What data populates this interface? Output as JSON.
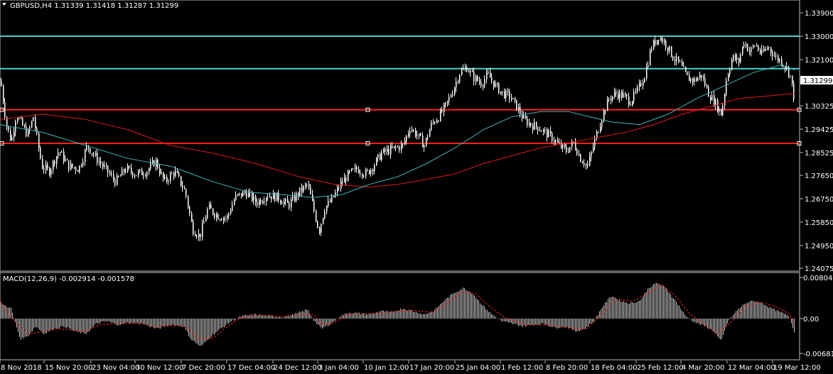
{
  "header": {
    "symbol_line": "GBPUSD,H4  1.31339 1.31418 1.31287 1.31299",
    "macd_line": "MACD(12,26,9) -0.002914 -0.001578"
  },
  "colors": {
    "background": "#000000",
    "candle": "#ffffff",
    "ma_fast": "#3fb8b8",
    "ma_slow": "#e01818",
    "hline_cyan": "#4fd0d0",
    "hline_red": "#ff2020",
    "macd_hist": "#c8c8c8",
    "macd_signal": "#ff2020",
    "price_tag_bg": "#ffffff",
    "price_tag_fg": "#000000"
  },
  "chart_data": [
    {
      "type": "candlestick",
      "name": "GBPUSD,H4",
      "current_price": "1.31299",
      "ylim": [
        1.24075,
        1.339
      ],
      "y_ticks": [
        "1.33900",
        "1.33000",
        "1.32100",
        "1.30325",
        "1.29425",
        "1.28525",
        "1.27650",
        "1.26750",
        "1.25850",
        "1.24950",
        "1.24075"
      ],
      "x_ticks": [
        "8 Nov 2018",
        "15 Nov 20:00",
        "23 Nov 04:00",
        "30 Nov 12:00",
        "7 Dec 20:00",
        "17 Dec 04:00",
        "24 Dec 12:00",
        "3 Jan 04:00",
        "10 Jan 12:00",
        "17 Jan 20:00",
        "25 Jan 04:00",
        "1 Feb 12:00",
        "8 Feb 20:00",
        "18 Feb 04:00",
        "25 Feb 12:00",
        "4 Mar 20:00",
        "12 Mar 04:00",
        "19 Mar 12:00"
      ],
      "horizontal_levels": [
        {
          "price": 1.33,
          "color": "cyan"
        },
        {
          "price": 1.3175,
          "color": "cyan"
        },
        {
          "price": 1.3017,
          "color": "red"
        },
        {
          "price": 1.2888,
          "color": "red"
        }
      ],
      "close_path": [
        [
          0,
          1.313
        ],
        [
          8,
          1.296
        ],
        [
          15,
          1.2895
        ],
        [
          22,
          1.3
        ],
        [
          30,
          1.296
        ],
        [
          38,
          1.292
        ],
        [
          46,
          1.299
        ],
        [
          58,
          1.28
        ],
        [
          68,
          1.278
        ],
        [
          82,
          1.286
        ],
        [
          96,
          1.28
        ],
        [
          110,
          1.279
        ],
        [
          122,
          1.288
        ],
        [
          135,
          1.283
        ],
        [
          150,
          1.278
        ],
        [
          162,
          1.274
        ],
        [
          176,
          1.279
        ],
        [
          190,
          1.277
        ],
        [
          205,
          1.278
        ],
        [
          218,
          1.282
        ],
        [
          230,
          1.274
        ],
        [
          245,
          1.278
        ],
        [
          260,
          1.27
        ],
        [
          270,
          1.256
        ],
        [
          280,
          1.253
        ],
        [
          292,
          1.264
        ],
        [
          305,
          1.261
        ],
        [
          318,
          1.26
        ],
        [
          330,
          1.268
        ],
        [
          345,
          1.27
        ],
        [
          360,
          1.266
        ],
        [
          375,
          1.269
        ],
        [
          390,
          1.268
        ],
        [
          405,
          1.265
        ],
        [
          420,
          1.27
        ],
        [
          432,
          1.273
        ],
        [
          440,
          1.264
        ],
        [
          448,
          1.255
        ],
        [
          456,
          1.264
        ],
        [
          466,
          1.267
        ],
        [
          478,
          1.273
        ],
        [
          490,
          1.277
        ],
        [
          502,
          1.279
        ],
        [
          514,
          1.277
        ],
        [
          524,
          1.28
        ],
        [
          536,
          1.285
        ],
        [
          546,
          1.286
        ],
        [
          556,
          1.287
        ],
        [
          566,
          1.288
        ],
        [
          576,
          1.295
        ],
        [
          586,
          1.292
        ],
        [
          596,
          1.288
        ],
        [
          606,
          1.296
        ],
        [
          616,
          1.299
        ],
        [
          626,
          1.303
        ],
        [
          636,
          1.309
        ],
        [
          646,
          1.316
        ],
        [
          656,
          1.318
        ],
        [
          666,
          1.314
        ],
        [
          676,
          1.312
        ],
        [
          686,
          1.315
        ],
        [
          696,
          1.311
        ],
        [
          706,
          1.308
        ],
        [
          716,
          1.307
        ],
        [
          726,
          1.303
        ],
        [
          736,
          1.298
        ],
        [
          746,
          1.296
        ],
        [
          756,
          1.295
        ],
        [
          766,
          1.293
        ],
        [
          776,
          1.291
        ],
        [
          786,
          1.288
        ],
        [
          796,
          1.286
        ],
        [
          806,
          1.289
        ],
        [
          816,
          1.283
        ],
        [
          826,
          1.28
        ],
        [
          836,
          1.29
        ],
        [
          846,
          1.299
        ],
        [
          856,
          1.306
        ],
        [
          866,
          1.308
        ],
        [
          876,
          1.307
        ],
        [
          886,
          1.305
        ],
        [
          896,
          1.309
        ],
        [
          906,
          1.315
        ],
        [
          916,
          1.326
        ],
        [
          926,
          1.33
        ],
        [
          936,
          1.327
        ],
        [
          946,
          1.322
        ],
        [
          956,
          1.319
        ],
        [
          966,
          1.314
        ],
        [
          976,
          1.313
        ],
        [
          986,
          1.315
        ],
        [
          996,
          1.308
        ],
        [
          1006,
          1.304
        ],
        [
          1014,
          1.3
        ],
        [
          1022,
          1.315
        ],
        [
          1030,
          1.322
        ],
        [
          1038,
          1.32
        ],
        [
          1046,
          1.328
        ],
        [
          1054,
          1.324
        ],
        [
          1062,
          1.327
        ],
        [
          1070,
          1.323
        ],
        [
          1080,
          1.326
        ],
        [
          1090,
          1.322
        ],
        [
          1100,
          1.32
        ],
        [
          1110,
          1.316
        ],
        [
          1118,
          1.304
        ]
      ],
      "ma_fast_path": [
        [
          0,
          1.296
        ],
        [
          60,
          1.293
        ],
        [
          120,
          1.288
        ],
        [
          180,
          1.283
        ],
        [
          240,
          1.28
        ],
        [
          300,
          1.274
        ],
        [
          350,
          1.27
        ],
        [
          400,
          1.269
        ],
        [
          440,
          1.268
        ],
        [
          480,
          1.269
        ],
        [
          520,
          1.273
        ],
        [
          560,
          1.276
        ],
        [
          600,
          1.281
        ],
        [
          640,
          1.287
        ],
        [
          680,
          1.294
        ],
        [
          720,
          1.299
        ],
        [
          760,
          1.301
        ],
        [
          800,
          1.301
        ],
        [
          830,
          1.299
        ],
        [
          860,
          1.297
        ],
        [
          900,
          1.296
        ],
        [
          940,
          1.3
        ],
        [
          980,
          1.306
        ],
        [
          1020,
          1.311
        ],
        [
          1060,
          1.316
        ],
        [
          1100,
          1.319
        ],
        [
          1118,
          1.317
        ]
      ],
      "ma_slow_path": [
        [
          0,
          1.298
        ],
        [
          60,
          1.3
        ],
        [
          120,
          1.298
        ],
        [
          180,
          1.294
        ],
        [
          240,
          1.288
        ],
        [
          300,
          1.285
        ],
        [
          360,
          1.281
        ],
        [
          420,
          1.276
        ],
        [
          470,
          1.273
        ],
        [
          520,
          1.272
        ],
        [
          560,
          1.273
        ],
        [
          600,
          1.275
        ],
        [
          640,
          1.277
        ],
        [
          680,
          1.281
        ],
        [
          720,
          1.284
        ],
        [
          760,
          1.287
        ],
        [
          800,
          1.289
        ],
        [
          840,
          1.291
        ],
        [
          880,
          1.293
        ],
        [
          920,
          1.296
        ],
        [
          960,
          1.3
        ],
        [
          1000,
          1.303
        ],
        [
          1040,
          1.306
        ],
        [
          1080,
          1.307
        ],
        [
          1118,
          1.308
        ]
      ]
    },
    {
      "type": "bar",
      "name": "MACD(12,26,9)",
      "ylim": [
        -0.006819,
        0.008047
      ],
      "y_ticks": [
        "0.008047",
        "0.00",
        "-0.006819"
      ],
      "histogram_path": [
        [
          0,
          0.003
        ],
        [
          15,
          0.002
        ],
        [
          28,
          -0.004
        ],
        [
          38,
          -0.0035
        ],
        [
          50,
          -0.0015
        ],
        [
          62,
          -0.003
        ],
        [
          75,
          -0.002
        ],
        [
          90,
          -0.0015
        ],
        [
          105,
          -0.0025
        ],
        [
          120,
          -0.003
        ],
        [
          135,
          -0.001
        ],
        [
          150,
          -0.0005
        ],
        [
          165,
          -0.0012
        ],
        [
          180,
          -0.0008
        ],
        [
          200,
          -0.001
        ],
        [
          220,
          -0.002
        ],
        [
          240,
          -0.0012
        ],
        [
          258,
          -0.0015
        ],
        [
          268,
          -0.004
        ],
        [
          282,
          -0.0055
        ],
        [
          296,
          -0.0035
        ],
        [
          310,
          -0.002
        ],
        [
          325,
          -0.0005
        ],
        [
          340,
          0.0005
        ],
        [
          360,
          0.0008
        ],
        [
          380,
          0.0005
        ],
        [
          400,
          0.0003
        ],
        [
          418,
          0.001
        ],
        [
          432,
          0.0018
        ],
        [
          442,
          -0.0005
        ],
        [
          452,
          -0.002
        ],
        [
          465,
          -0.001
        ],
        [
          478,
          0.0005
        ],
        [
          492,
          0.0012
        ],
        [
          506,
          0.001
        ],
        [
          520,
          0.0008
        ],
        [
          536,
          0.0015
        ],
        [
          550,
          0.0012
        ],
        [
          566,
          0.002
        ],
        [
          580,
          0.0015
        ],
        [
          596,
          0.0008
        ],
        [
          610,
          0.0015
        ],
        [
          624,
          0.0035
        ],
        [
          638,
          0.005
        ],
        [
          652,
          0.006
        ],
        [
          664,
          0.005
        ],
        [
          676,
          0.003
        ],
        [
          690,
          0.001
        ],
        [
          705,
          -0.0005
        ],
        [
          720,
          -0.001
        ],
        [
          735,
          -0.0015
        ],
        [
          750,
          -0.0012
        ],
        [
          765,
          -0.001
        ],
        [
          780,
          -0.0018
        ],
        [
          795,
          -0.0015
        ],
        [
          810,
          -0.0025
        ],
        [
          822,
          -0.002
        ],
        [
          835,
          -0.0005
        ],
        [
          848,
          0.0025
        ],
        [
          860,
          0.0045
        ],
        [
          872,
          0.0035
        ],
        [
          886,
          0.003
        ],
        [
          900,
          0.0035
        ],
        [
          912,
          0.006
        ],
        [
          924,
          0.007
        ],
        [
          936,
          0.006
        ],
        [
          950,
          0.0035
        ],
        [
          964,
          0.0005
        ],
        [
          978,
          -0.0008
        ],
        [
          992,
          -0.0015
        ],
        [
          1004,
          -0.0025
        ],
        [
          1014,
          -0.0045
        ],
        [
          1024,
          -0.0005
        ],
        [
          1036,
          0.0015
        ],
        [
          1048,
          0.003
        ],
        [
          1060,
          0.0035
        ],
        [
          1072,
          0.003
        ],
        [
          1085,
          0.002
        ],
        [
          1098,
          0.0012
        ],
        [
          1110,
          0.0005
        ],
        [
          1118,
          -0.003
        ]
      ],
      "signal_path": [
        [
          0,
          0.0035
        ],
        [
          20,
          -0.0005
        ],
        [
          40,
          -0.003
        ],
        [
          60,
          -0.0025
        ],
        [
          80,
          -0.002
        ],
        [
          100,
          -0.0022
        ],
        [
          120,
          -0.0025
        ],
        [
          140,
          -0.0012
        ],
        [
          160,
          -0.001
        ],
        [
          180,
          -0.0009
        ],
        [
          200,
          -0.001
        ],
        [
          220,
          -0.0016
        ],
        [
          240,
          -0.0014
        ],
        [
          260,
          -0.0014
        ],
        [
          280,
          -0.004
        ],
        [
          300,
          -0.0038
        ],
        [
          320,
          -0.0015
        ],
        [
          340,
          0.0002
        ],
        [
          360,
          0.0006
        ],
        [
          380,
          0.0006
        ],
        [
          400,
          0.0004
        ],
        [
          420,
          0.0008
        ],
        [
          440,
          0.0008
        ],
        [
          455,
          -0.0012
        ],
        [
          470,
          -0.0008
        ],
        [
          490,
          0.0008
        ],
        [
          520,
          0.001
        ],
        [
          550,
          0.0013
        ],
        [
          580,
          0.0016
        ],
        [
          610,
          0.0012
        ],
        [
          630,
          0.003
        ],
        [
          650,
          0.0052
        ],
        [
          670,
          0.0048
        ],
        [
          690,
          0.0022
        ],
        [
          710,
          0.0002
        ],
        [
          740,
          -0.0012
        ],
        [
          770,
          -0.0012
        ],
        [
          800,
          -0.0018
        ],
        [
          825,
          -0.002
        ],
        [
          845,
          0.0005
        ],
        [
          865,
          0.0038
        ],
        [
          890,
          0.0034
        ],
        [
          910,
          0.0048
        ],
        [
          930,
          0.0066
        ],
        [
          950,
          0.0045
        ],
        [
          970,
          0.001
        ],
        [
          990,
          -0.001
        ],
        [
          1010,
          -0.003
        ],
        [
          1030,
          -0.0005
        ],
        [
          1050,
          0.0025
        ],
        [
          1070,
          0.0032
        ],
        [
          1090,
          0.0024
        ],
        [
          1110,
          0.001
        ],
        [
          1118,
          -0.001
        ]
      ]
    }
  ]
}
